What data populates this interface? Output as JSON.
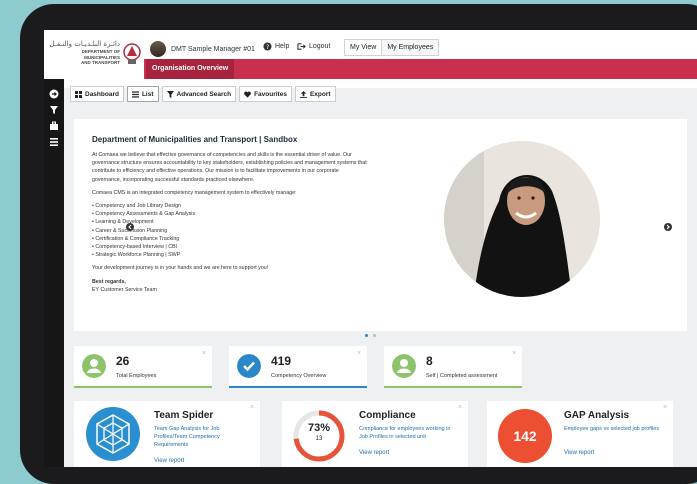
{
  "header": {
    "logo_ar": "دائـرة البلـديـات والنـقـل",
    "logo_en_line1": "DEPARTMENT OF MUNICIPALITIES",
    "logo_en_line2": "AND TRANSPORT",
    "user_name": "DMT Sample Manager #01",
    "help_label": "Help",
    "logout_label": "Logout",
    "view_tabs": [
      "My View",
      "My Employees"
    ],
    "org_tab": "Organisation Overview"
  },
  "toolbar": {
    "items": [
      "Dashboard",
      "List",
      "Advanced Search",
      "Favourites",
      "Export"
    ]
  },
  "main_card": {
    "title": "Department of Municipalities and Transport | Sandbox",
    "para1": "At Comaea we believe that effective governance of competencies and skills is the essential driver of value. Our governance structure ensures accountability to key stakeholders, establishing policies and management systems that contribute to efficiency and effective operations. Our mission is to facilitate improvements in our corporate governance, incorporating successful standards practiced elsewhere.",
    "para2": "Comaea CMS is an integrated competency management system to effectively manage:",
    "bullets": [
      "Competency and Job Library Design",
      "Competency Assessments & Gap Analysis",
      "Learning & Development",
      "Career & Succession Planning",
      "Certification & Compliance Tracking",
      "Competency-based Interview | CBI",
      "Strategic Workforce Planning | SWP"
    ],
    "para3": "Your  development journey is in your hands and we are here to support you!",
    "sign1": "Best regards,",
    "sign2": "EY Customer Service Team"
  },
  "stats": [
    {
      "value": "26",
      "label": "Total Employees",
      "color": "#8cc36b"
    },
    {
      "value": "419",
      "label": "Competency Overview",
      "color": "#2a88c8"
    },
    {
      "value": "8",
      "label": "Self | Completed assessment",
      "color": "#8cc36b"
    }
  ],
  "features": [
    {
      "title": "Team Spider",
      "desc": "Team Gap Analysis for Job Profiles/Team Competency Requirements",
      "link": "View report",
      "color": "#2a8fd0"
    },
    {
      "title": "Compliance",
      "desc": "Compliance for employees working in Job Profiles in selected unit",
      "link": "View report",
      "percent": "73%",
      "count": "13",
      "fill": 0.73,
      "color": "#e7533a"
    },
    {
      "title": "GAP Analysis",
      "desc": "Employee gaps vs selected job profiles",
      "link": "View report",
      "value": "142",
      "color": "#ec4f32"
    }
  ],
  "close_glyph": "×",
  "colors": {
    "accent": "#c8304e",
    "sidebar": "#161616",
    "link": "#1e6fa8"
  }
}
